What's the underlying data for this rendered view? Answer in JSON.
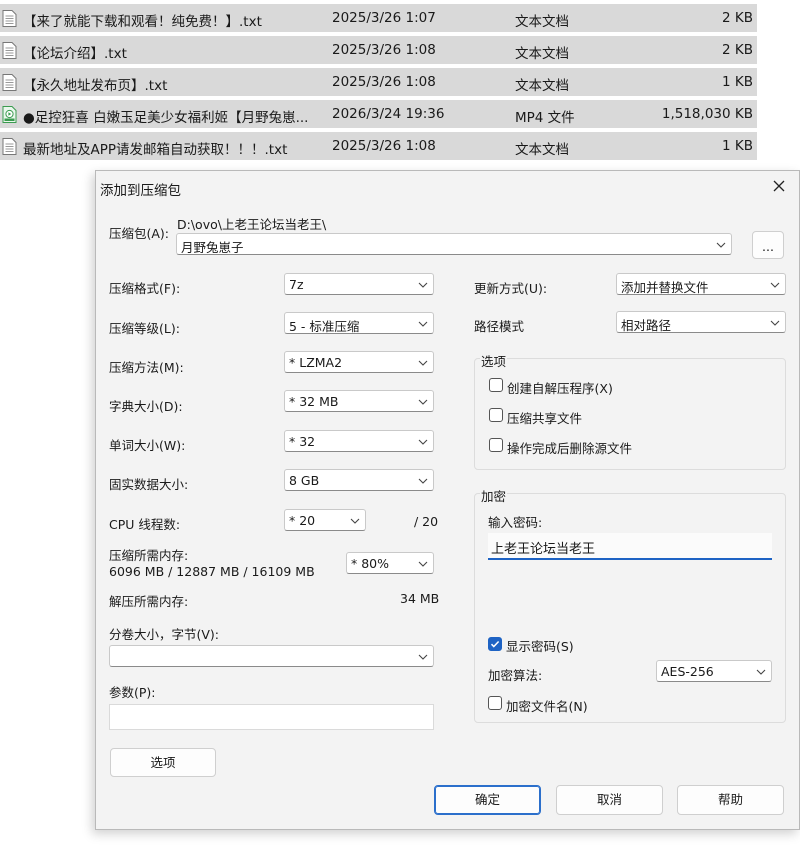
{
  "files": [
    {
      "name": "【来了就能下载和观看！纯免费！】.txt",
      "date": "2025/3/26 1:07",
      "type": "文本文档",
      "size": "2 KB",
      "icon": "text-file-icon"
    },
    {
      "name": "【论坛介绍】.txt",
      "date": "2025/3/26 1:08",
      "type": "文本文档",
      "size": "2 KB",
      "icon": "text-file-icon"
    },
    {
      "name": "【永久地址发布页】.txt",
      "date": "2025/3/26 1:08",
      "type": "文本文档",
      "size": "1 KB",
      "icon": "text-file-icon"
    },
    {
      "name": "●足控狂喜 白嫩玉足美少女福利姬【月野兔崽...",
      "date": "2026/3/24 19:36",
      "type": "MP4 文件",
      "size": "1,518,030 KB",
      "icon": "video-file-icon"
    },
    {
      "name": "最新地址及APP请发邮箱自动获取！！！.txt",
      "date": "2025/3/26 1:08",
      "type": "文本文档",
      "size": "1 KB",
      "icon": "text-file-icon"
    }
  ],
  "dialog": {
    "title": "添加到压缩包",
    "archive_label": "压缩包(A):",
    "archive_path": "D:\\ovo\\上老王论坛当老王\\",
    "archive_name": "月野兔崽子",
    "browse_label": "...",
    "format_label": "压缩格式(F):",
    "format_value": "7z",
    "level_label": "压缩等级(L):",
    "level_value": "5 - 标准压缩",
    "method_label": "压缩方法(M):",
    "method_value": "*  LZMA2",
    "dict_label": "字典大小(D):",
    "dict_value": "*  32 MB",
    "word_label": "单词大小(W):",
    "word_value": "*  32",
    "solid_label": "固实数据大小:",
    "solid_value": "8 GB",
    "cpu_label": "CPU 线程数:",
    "cpu_value": "*  20",
    "cpu_total": "/ 20",
    "mem_label": "压缩所需内存:",
    "mem_detail": "6096 MB / 12887 MB / 16109 MB",
    "mem_value": "*  80%",
    "decomp_label": "解压所需内存:",
    "decomp_value": "34 MB",
    "split_label": "分卷大小，字节(V):",
    "split_value": "",
    "params_label": "参数(P):",
    "params_value": "",
    "update_label": "更新方式(U):",
    "update_value": "添加并替换文件",
    "pathmode_label": "路径模式",
    "pathmode_value": "相对路径",
    "options_title": "选项",
    "opt_sfx": "创建自解压程序(X)",
    "opt_shared": "压缩共享文件",
    "opt_delete": "操作完成后删除源文件",
    "encrypt_title": "加密",
    "pw_label": "输入密码:",
    "pw_value": "上老王论坛当老王",
    "show_pw": "显示密码(S)",
    "show_pw_checked": true,
    "algo_label": "加密算法:",
    "algo_value": "AES-256",
    "encrypt_names": "加密文件名(N)",
    "options_button": "选项",
    "ok_button": "确定",
    "cancel_button": "取消",
    "help_button": "帮助"
  },
  "colors": {
    "accent": "#1e63c4",
    "row_bg": "#d9d9d9",
    "dialog_bg": "#f3f3f3"
  }
}
